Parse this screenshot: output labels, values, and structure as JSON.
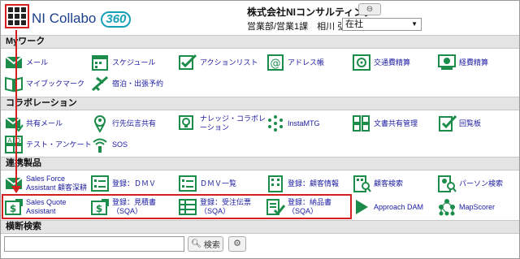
{
  "header": {
    "logo_main": "NI Collabo",
    "logo_num": "360",
    "company": "株式会社NIコンサルティング",
    "dept_user": "営業部/営業1課　相川 弘",
    "status": "在社"
  },
  "sections": {
    "mywork": "Myワーク",
    "collab": "コラボレーション",
    "linked": "連携製品",
    "search": "横断検索"
  },
  "mywork": [
    {
      "label": "メール"
    },
    {
      "label": "スケジュール"
    },
    {
      "label": "アクションリスト"
    },
    {
      "label": "アドレス帳"
    },
    {
      "label": "交通費精算"
    },
    {
      "label": "経費精算"
    },
    {
      "label": "マイブックマーク"
    },
    {
      "label": "宿泊・出張予約"
    }
  ],
  "collab": [
    {
      "label": "共有メール"
    },
    {
      "label": "行先伝言共有"
    },
    {
      "label": "ナレッジ・コラボレーション"
    },
    {
      "label": "InstaMTG"
    },
    {
      "label": "文書共有管理"
    },
    {
      "label": "回覧板"
    },
    {
      "label": "テスト・アンケート"
    },
    {
      "label": "SOS"
    }
  ],
  "linked": [
    {
      "label": "Sales Force Assistant 顧客深耕"
    },
    {
      "label": "登録：ＤＭＶ"
    },
    {
      "label": "ＤＭＶ一覧"
    },
    {
      "label": "登録：顧客情報"
    },
    {
      "label": "顧客検索"
    },
    {
      "label": "パーソン検索"
    },
    {
      "label": "Sales Quote Assistant"
    },
    {
      "label": "登録：見積書（SQA）"
    },
    {
      "label": "登録：受注伝票（SQA）"
    },
    {
      "label": "登録：納品書（SQA）"
    },
    {
      "label": "Approach DAM"
    },
    {
      "label": "MapScorer"
    }
  ],
  "search": {
    "button": "検索",
    "value": ""
  }
}
